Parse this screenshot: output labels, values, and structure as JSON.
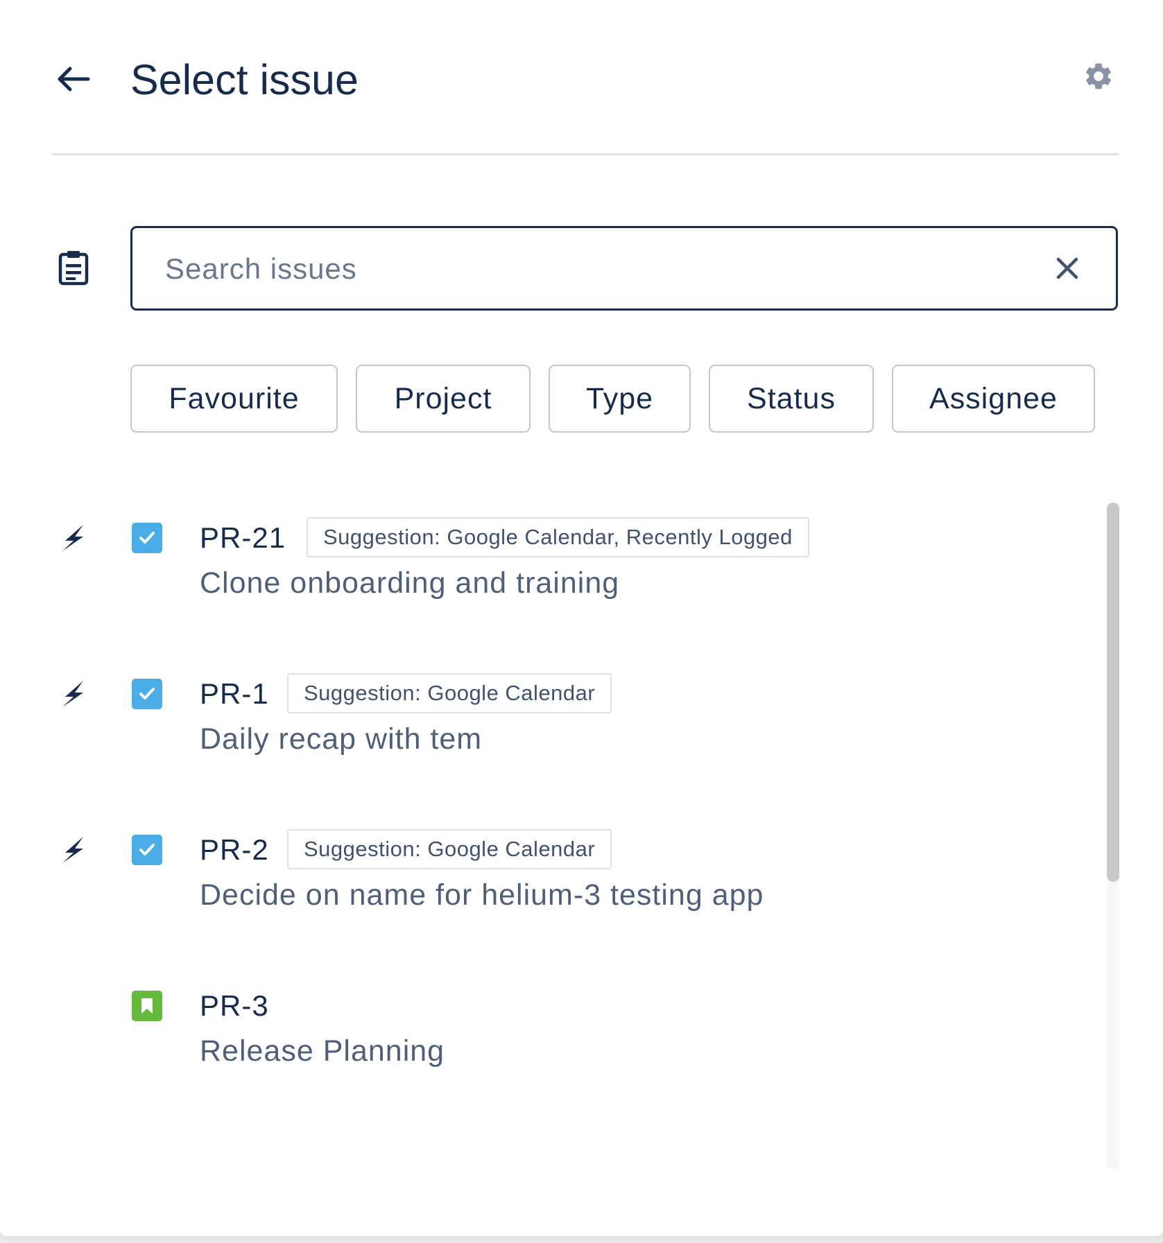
{
  "header": {
    "title": "Select issue",
    "back_icon": "arrow-left-icon",
    "settings_icon": "gear-icon"
  },
  "search": {
    "placeholder": "Search issues",
    "value": "",
    "leading_icon": "clipboard-icon",
    "clear_icon": "close-icon"
  },
  "filters": [
    {
      "label": "Favourite"
    },
    {
      "label": "Project"
    },
    {
      "label": "Type"
    },
    {
      "label": "Status"
    },
    {
      "label": "Assignee"
    }
  ],
  "issues": [
    {
      "key": "PR-21",
      "badge": "Suggestion: Google Calendar, Recently Logged",
      "summary": "Clone onboarding and training",
      "type": "task",
      "priority_icon": "lightning-bolt-icon"
    },
    {
      "key": "PR-1",
      "badge": "Suggestion: Google Calendar",
      "summary": "Daily recap with tem",
      "type": "task",
      "priority_icon": "lightning-bolt-icon"
    },
    {
      "key": "PR-2",
      "badge": "Suggestion: Google Calendar",
      "summary": "Decide on name for helium-3 testing app",
      "type": "task",
      "priority_icon": "lightning-bolt-icon"
    },
    {
      "key": "PR-3",
      "badge": "",
      "summary": "Release Planning",
      "type": "story",
      "priority_icon": ""
    }
  ],
  "colors": {
    "text_primary": "#172b4d",
    "text_secondary": "#505f79",
    "task_blue": "#4bade8",
    "story_green": "#63ba3c",
    "border": "#c1c7d0"
  }
}
